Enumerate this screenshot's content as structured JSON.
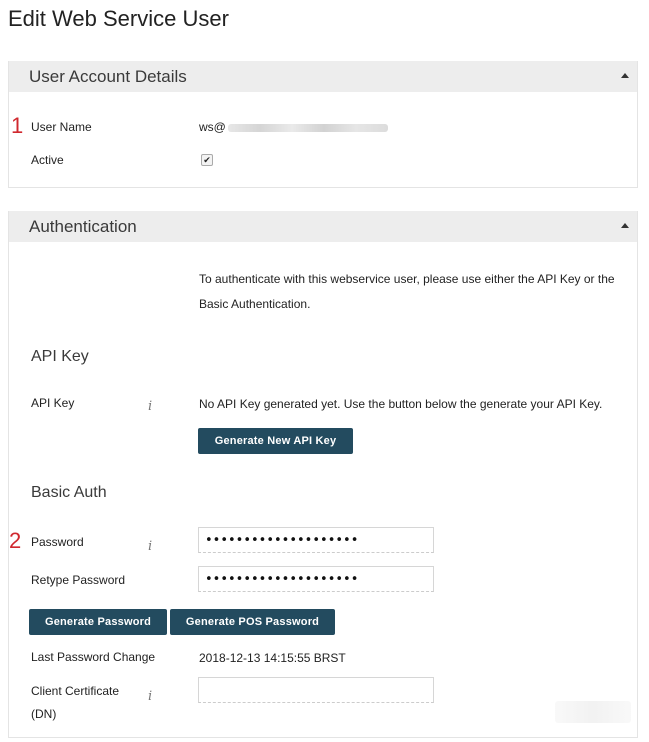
{
  "page": {
    "title": "Edit Web Service User"
  },
  "account_panel": {
    "title": "User Account Details",
    "marker": "1",
    "username_label": "User Name",
    "username_value": "ws@",
    "active_label": "Active",
    "active_checked": true,
    "check_mark": "✔"
  },
  "auth_panel": {
    "title": "Authentication",
    "intro_line1": "To authenticate with this webservice user, please use either the API Key or the",
    "intro_line2": "Basic Authentication.",
    "api_section_title": "API Key",
    "api_key_label": "API Key",
    "info_glyph": "i",
    "api_key_text": "No API Key generated yet. Use the button below the generate your API Key.",
    "generate_api_key_button": "Generate New API Key",
    "basic_section_title": "Basic Auth",
    "marker": "2",
    "password_label": "Password",
    "password_value": "••••••••••••••••••••",
    "retype_label": "Retype Password",
    "retype_value": "••••••••••••••••••••",
    "generate_password_button": "Generate Password",
    "generate_pos_password_button": "Generate POS Password",
    "last_change_label": "Last Password Change",
    "last_change_value": "2018-12-13 14:15:55 BRST",
    "client_cert_label_line1": "Client Certificate",
    "client_cert_label_line2": "(DN)",
    "client_cert_value": ""
  }
}
